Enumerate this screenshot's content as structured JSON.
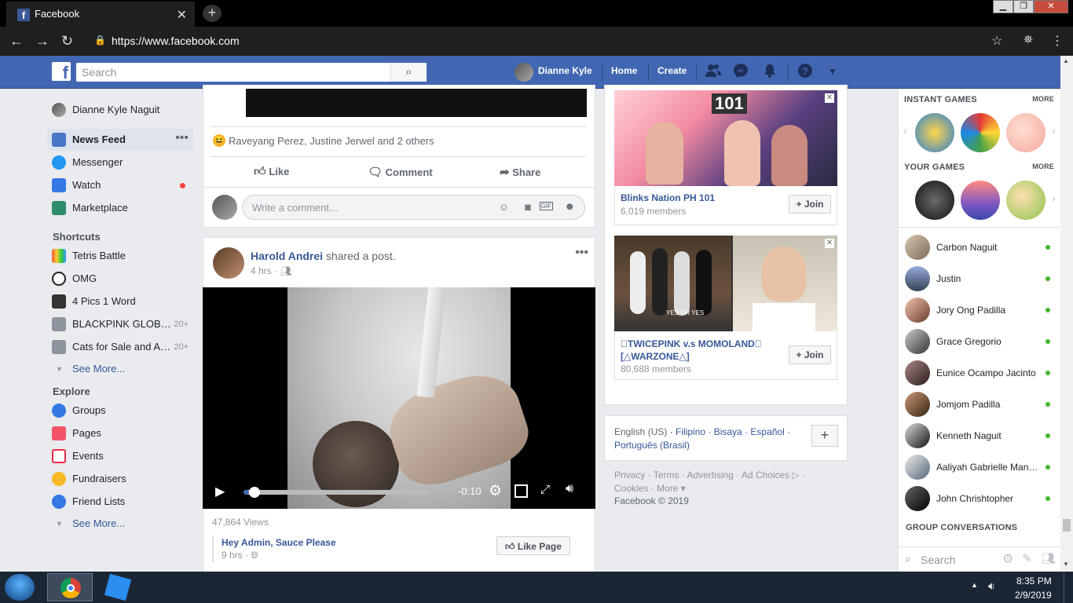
{
  "browser": {
    "tab_title": "Facebook",
    "tab_favicon": "f",
    "url": "https://www.facebook.com"
  },
  "topbar": {
    "search_placeholder": "Search",
    "user_name": "Dianne Kyle",
    "home": "Home",
    "create": "Create"
  },
  "left_nav": {
    "profile_name": "Dianne Kyle Naguit",
    "items": [
      {
        "label": "News Feed"
      },
      {
        "label": "Messenger"
      },
      {
        "label": "Watch"
      },
      {
        "label": "Marketplace"
      }
    ],
    "shortcuts_header": "Shortcuts",
    "shortcuts": [
      {
        "label": "Tetris Battle",
        "count": ""
      },
      {
        "label": "OMG",
        "count": ""
      },
      {
        "label": "4 Pics 1 Word",
        "count": ""
      },
      {
        "label": "BLACKPINK GLOB…",
        "count": "20+"
      },
      {
        "label": "Cats for Sale and A…",
        "count": "20+"
      }
    ],
    "see_more": "See More...",
    "explore_header": "Explore",
    "explore": [
      {
        "label": "Groups"
      },
      {
        "label": "Pages"
      },
      {
        "label": "Events"
      },
      {
        "label": "Fundraisers"
      },
      {
        "label": "Friend Lists"
      }
    ],
    "see_more_2": "See More..."
  },
  "post1": {
    "reactions": "Raveyang Perez, Justine Jerwel and 2 others",
    "like": "Like",
    "comment": "Comment",
    "share": "Share",
    "comment_placeholder": "Write a comment..."
  },
  "post2": {
    "author": "Harold Andrei",
    "action": " shared a post.",
    "time": "4 hrs",
    "video_time": "-0:10",
    "views": "47,864 Views",
    "shared_page": "Hey Admin, Sauce Please",
    "shared_time": "9 hrs",
    "like_page": "Like Page",
    "progress_fraction": 0.03
  },
  "suggested_groups": [
    {
      "name": "Blinks Nation PH 101",
      "members": "6,019 members",
      "join": "+ Join",
      "banner_text": "101"
    },
    {
      "name": "\u0000TWICEPINK v.s MOMOLAND\u0000 [△WARZONE△]",
      "members": "80,688 members",
      "join": "+ Join",
      "banner_text": "YES OR YES"
    }
  ],
  "language": {
    "current": "English (US)",
    "others": "Filipino · Bisaya · Español · Português (Brasil)"
  },
  "footer": {
    "links": "Privacy · Terms · Advertising · Ad Choices ▷ · Cookies · More ▾",
    "copyright": "Facebook © 2019"
  },
  "rail": {
    "instant_games": "INSTANT GAMES",
    "your_games": "YOUR GAMES",
    "more": "MORE",
    "group_conversations": "GROUP CONVERSATIONS",
    "search_placeholder": "Search",
    "contacts": [
      {
        "name": "Carbon Naguit"
      },
      {
        "name": "Justin"
      },
      {
        "name": "Jory Ong Padilla"
      },
      {
        "name": "Grace Gregorio"
      },
      {
        "name": "Eunice Ocampo Jacinto"
      },
      {
        "name": "Jomjom Padilla"
      },
      {
        "name": "Kenneth Naguit"
      },
      {
        "name": "Aaliyah Gabrielle Man…"
      },
      {
        "name": "John Chrishtopher"
      }
    ]
  },
  "taskbar": {
    "time": "8:35 PM",
    "date": "2/9/2019"
  }
}
